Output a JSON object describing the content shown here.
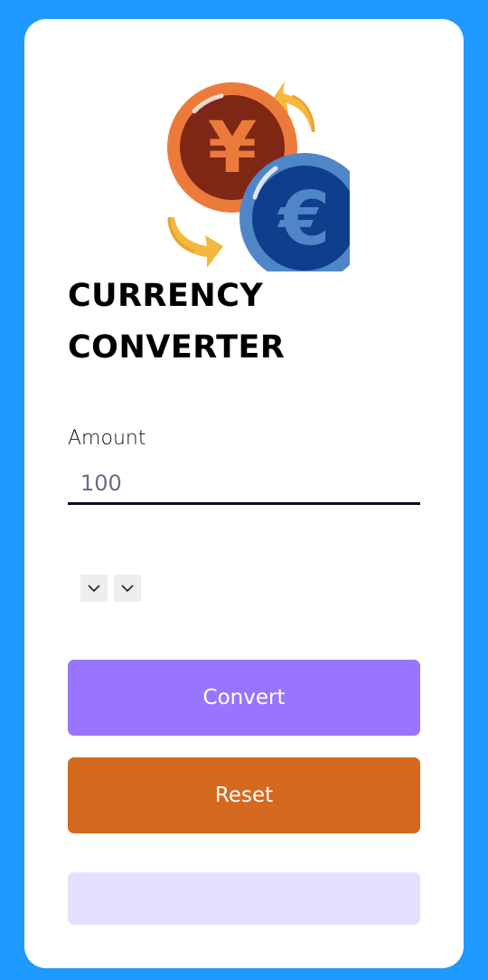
{
  "app": {
    "title_line1": "CURRENCY",
    "title_line2": "CONVERTER"
  },
  "logo": {
    "icon": "currency-exchange-icon",
    "coin_back_symbol": "¥",
    "coin_front_symbol": "€"
  },
  "form": {
    "amount_label": "Amount",
    "amount_value": "100",
    "from_select_icon": "chevron-down-icon",
    "to_select_icon": "chevron-down-icon"
  },
  "buttons": {
    "convert_label": "Convert",
    "reset_label": "Reset"
  },
  "result": {
    "text": ""
  },
  "colors": {
    "background": "#1E99FF",
    "card": "#FFFFFF",
    "convert_button": "#9975FF",
    "reset_button": "#D4691F",
    "result_box": "#E5DEFD",
    "input_underline": "#0C0F2A"
  }
}
